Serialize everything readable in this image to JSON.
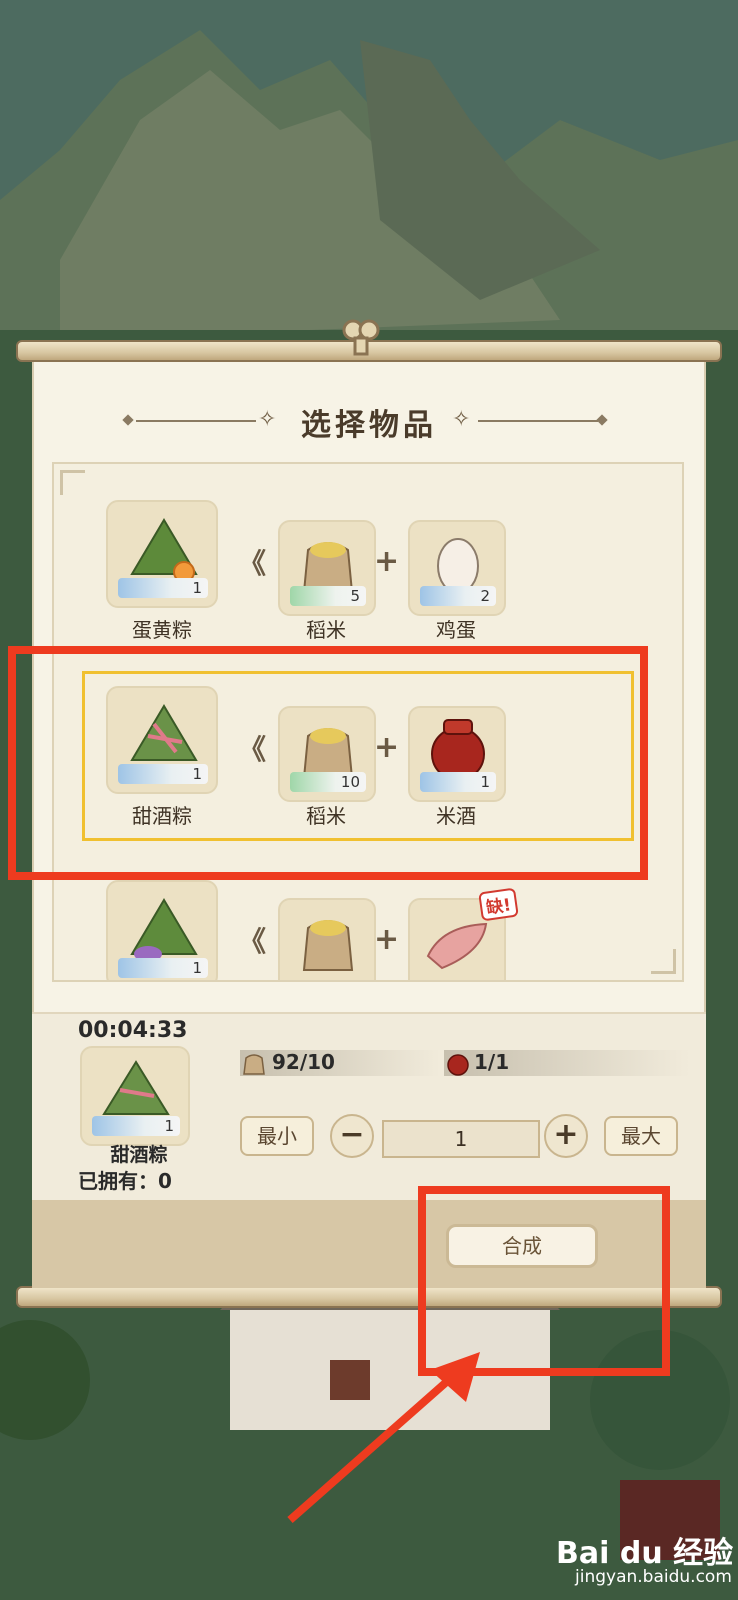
{
  "dialog": {
    "title": "选择物品"
  },
  "recipes": [
    {
      "product": {
        "name": "蛋黄粽",
        "count": "1"
      },
      "ingredients": [
        {
          "name": "稻米",
          "count": "5"
        },
        {
          "name": "鸡蛋",
          "count": "2"
        }
      ]
    },
    {
      "product": {
        "name": "甜酒粽",
        "count": "1"
      },
      "ingredients": [
        {
          "name": "稻米",
          "count": "10"
        },
        {
          "name": "米酒",
          "count": "1"
        }
      ],
      "selected": true
    },
    {
      "product": {
        "name": "",
        "count": "1"
      },
      "ingredients": [
        {
          "name": "",
          "count": ""
        },
        {
          "name": "",
          "count": ""
        }
      ],
      "missing_badge": "缺!"
    }
  ],
  "detail": {
    "timer": "00:04:33",
    "product_name": "甜酒粽",
    "product_count": "1",
    "owned": "已拥有：0",
    "materials": [
      {
        "icon": "rice-sack-icon",
        "value": "92/10"
      },
      {
        "icon": "wine-jar-icon",
        "value": "1/1"
      }
    ]
  },
  "quantity": {
    "min_label": "最小",
    "max_label": "最大",
    "minus": "−",
    "plus": "+",
    "value": "1"
  },
  "actions": {
    "synthesize_label": "合成"
  },
  "watermark": {
    "brand": "Bai du 经验",
    "url": "jingyan.baidu.com"
  },
  "colors": {
    "highlight_box": "#ee3b1f",
    "selection_border": "#f0c030",
    "panel_bg": "#f7f3e6"
  }
}
